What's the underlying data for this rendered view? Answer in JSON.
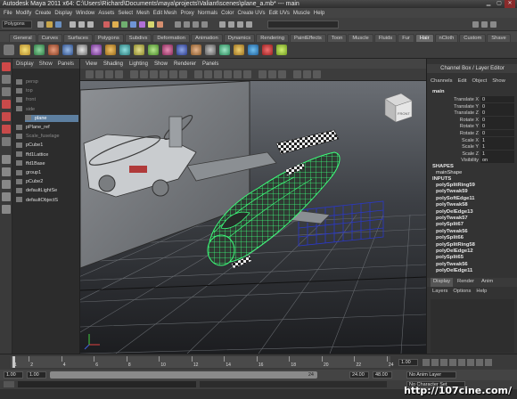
{
  "window": {
    "title": "Autodesk Maya 2011 x64: C:\\Users\\Richard\\Documents\\maya\\projects\\Valiant\\scenes\\plane_a.mb*  ---  main"
  },
  "menubar": [
    "File",
    "Modify",
    "Create",
    "Display",
    "Window",
    "Assets",
    "Select",
    "Mesh",
    "Edit Mesh",
    "Proxy",
    "Normals",
    "Color",
    "Create UVs",
    "Edit UVs",
    "Muscle",
    "Help"
  ],
  "statusline": {
    "mode": "Polygons"
  },
  "shelf": {
    "tabs": [
      "General",
      "Curves",
      "Surfaces",
      "Polygons",
      "Subdivs",
      "Deformation",
      "Animation",
      "Dynamics",
      "Rendering",
      "PaintEffects",
      "Toon",
      "Muscle",
      "Fluids",
      "Fur",
      "Hair",
      "nCloth",
      "Custom",
      "Shave"
    ],
    "active_tab": "Hair"
  },
  "outliner": {
    "menu": [
      "Display",
      "Show",
      "Panels"
    ],
    "items": [
      {
        "label": "persp",
        "style": "dim"
      },
      {
        "label": "top",
        "style": "dim"
      },
      {
        "label": "front",
        "style": "dim"
      },
      {
        "label": "side",
        "style": "dim"
      },
      {
        "label": "plane",
        "style": "selected"
      },
      {
        "label": "pPlane_ref",
        "style": "normal"
      },
      {
        "label": "Scale_fuselage",
        "style": "dim"
      },
      {
        "label": "pCube1",
        "style": "normal"
      },
      {
        "label": "ffd1Lattice",
        "style": "normal"
      },
      {
        "label": "ffd1Base",
        "style": "normal"
      },
      {
        "label": "group1",
        "style": "normal"
      },
      {
        "label": "pCube2",
        "style": "normal"
      },
      {
        "label": "defaultLightSe",
        "style": "normal"
      },
      {
        "label": "defaultObjectS",
        "style": "normal"
      }
    ]
  },
  "viewport": {
    "menu": [
      "View",
      "Shading",
      "Lighting",
      "Show",
      "Renderer",
      "Panels"
    ],
    "view_cube_label": "FRONT"
  },
  "channel_box": {
    "header": "Channel Box / Layer Editor",
    "menu": [
      "Channels",
      "Edit",
      "Object",
      "Show"
    ],
    "object": "main",
    "attributes": [
      {
        "name": "Translate X",
        "value": "0"
      },
      {
        "name": "Translate Y",
        "value": "0"
      },
      {
        "name": "Translate Z",
        "value": "0"
      },
      {
        "name": "Rotate X",
        "value": "0"
      },
      {
        "name": "Rotate Y",
        "value": "0"
      },
      {
        "name": "Rotate Z",
        "value": "0"
      },
      {
        "name": "Scale X",
        "value": "1"
      },
      {
        "name": "Scale Y",
        "value": "1"
      },
      {
        "name": "Scale Z",
        "value": "1"
      },
      {
        "name": "Visibility",
        "value": "on"
      }
    ],
    "shapes_label": "SHAPES",
    "shape": "mainShape",
    "inputs_label": "INPUTS",
    "inputs": [
      "polySplitRing59",
      "polyTweak59",
      "polySoftEdge11",
      "polyTweak58",
      "polyDelEdge13",
      "polyTweak57",
      "polySplit67",
      "polyTweak56",
      "polySplit66",
      "polySplitRing58",
      "polyDelEdge12",
      "polySplit65",
      "polyTweak56",
      "polyDelEdge11"
    ],
    "layer_tabs": [
      "Display",
      "Render",
      "Anim"
    ],
    "layer_menu": [
      "Layers",
      "Options",
      "Help"
    ]
  },
  "timeline": {
    "ticks": [
      "1",
      "2",
      "4",
      "6",
      "8",
      "10",
      "12",
      "14",
      "16",
      "18",
      "20",
      "22",
      "24"
    ],
    "current_frame": "1.00",
    "range_start": "1.00",
    "range_inner_start": "1.00",
    "range_end": "24",
    "anim_end": "24.00",
    "anim_end2": "48.00",
    "anim_layer": "No Anim Layer",
    "char_set": "No Character Set"
  },
  "watermark": "http://107cine.com/",
  "colors": {
    "selection": "#5d7fa0",
    "wire_green": "#3cff7a",
    "lattice_blue": "#2a38c8",
    "background": "#3b3b3b"
  }
}
